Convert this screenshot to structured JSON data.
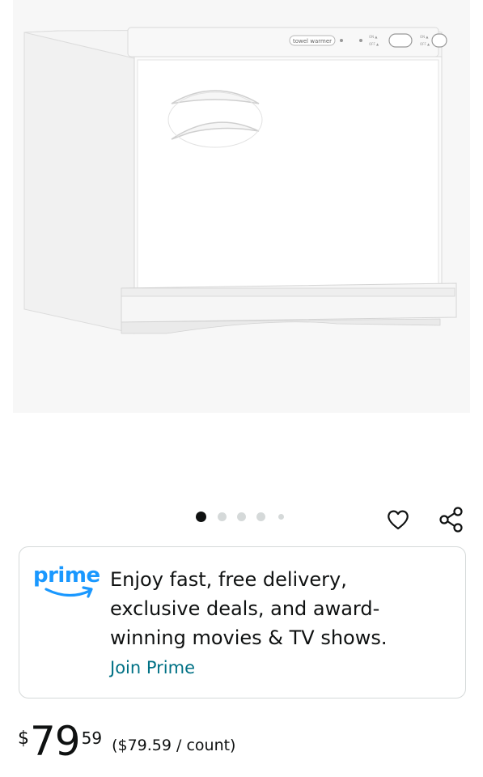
{
  "product": {
    "image_alt": "White towel warmer cabinet",
    "panel_label": "towel warmer",
    "image_count": 5,
    "active_image": 1
  },
  "actions": {
    "wishlist_icon": "heart-outline-icon",
    "share_icon": "share-icon"
  },
  "prime": {
    "logo_text": "prime",
    "message": "Enjoy fast, free delivery, exclusive deals, and award-winning movies & TV shows.",
    "join_label": "Join Prime",
    "brand_color": "#1a98ff",
    "link_color": "#007185"
  },
  "price": {
    "currency_symbol": "$",
    "whole": "79",
    "fraction": "59",
    "per_unit": "($79.59 / count)"
  }
}
